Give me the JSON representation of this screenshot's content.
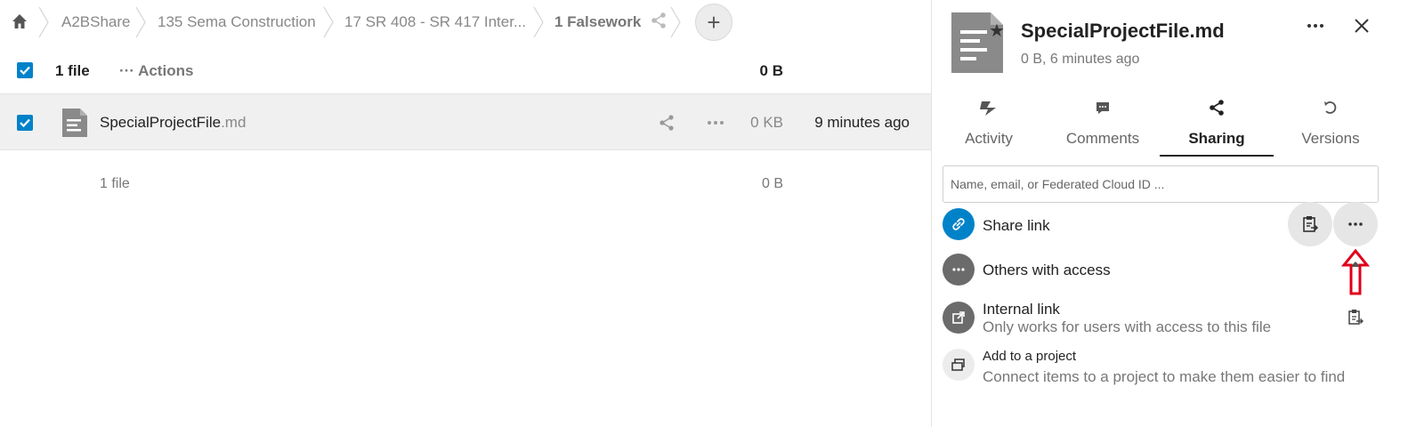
{
  "breadcrumb": {
    "items": [
      {
        "label": "A2BShare"
      },
      {
        "label": "135 Sema Construction"
      },
      {
        "label": "17 SR 408 - SR 417 Inter..."
      },
      {
        "label": "1 Falsework"
      }
    ],
    "new_button_label": "+"
  },
  "list_header": {
    "selected_count": "1 file",
    "actions_label": "Actions",
    "total_size": "0 B"
  },
  "files": [
    {
      "basename": "SpecialProjectFile",
      "extension": ".md",
      "size": "0 KB",
      "modified": "9 minutes ago"
    }
  ],
  "summary": {
    "count": "1 file",
    "size": "0 B"
  },
  "sidebar": {
    "title": "SpecialProjectFile.md",
    "subtitle": "0 B, 6 minutes ago",
    "tabs": [
      {
        "label": "Activity",
        "icon": "activity-icon"
      },
      {
        "label": "Comments",
        "icon": "comment-icon"
      },
      {
        "label": "Sharing",
        "icon": "share-icon",
        "active": true
      },
      {
        "label": "Versions",
        "icon": "history-icon"
      }
    ],
    "share_input_placeholder": "Name, email, or Federated Cloud ID ...",
    "share_link": {
      "label": "Share link",
      "icon": "link-icon"
    },
    "others_with_access": {
      "label": "Others with access",
      "icon": "more-icon"
    },
    "internal_link": {
      "label": "Internal link",
      "description": "Only works for users with access to this file",
      "icon": "external-link-icon"
    },
    "add_to_project": {
      "label": "Add to a project",
      "description": "Connect items to a project to make them easier to find",
      "icon": "project-icon"
    }
  },
  "colors": {
    "primary": "#0082c9",
    "avatar_gray": "#6b6b6b",
    "annotation_red": "#e0001a"
  }
}
